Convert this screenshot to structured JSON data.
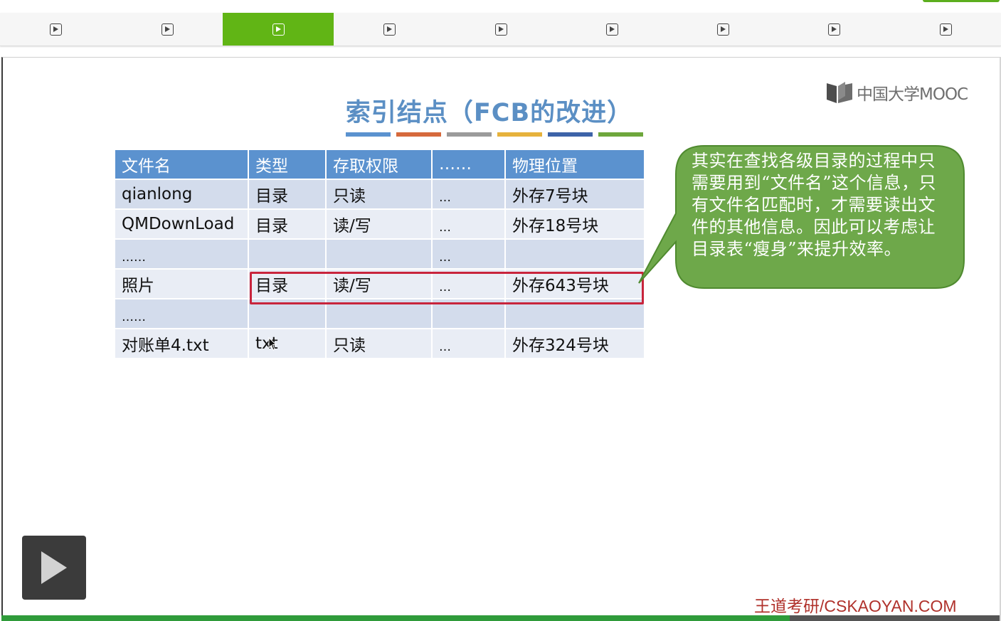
{
  "tabs": [
    {
      "icon": "play-icon",
      "active": false
    },
    {
      "icon": "play-icon",
      "active": false
    },
    {
      "icon": "play-icon",
      "active": true
    },
    {
      "icon": "play-icon",
      "active": false
    },
    {
      "icon": "play-icon",
      "active": false
    },
    {
      "icon": "play-icon",
      "active": false
    },
    {
      "icon": "play-icon",
      "active": false
    },
    {
      "icon": "play-icon",
      "active": false
    },
    {
      "icon": "play-icon",
      "active": false
    }
  ],
  "slide": {
    "title": "索引结点（FCB的改进）",
    "title_bar_colors": [
      "#5b92cf",
      "#d6693c",
      "#9b9b9b",
      "#e6b23c",
      "#3d63a8",
      "#6ea73c"
    ],
    "logo_text": "中国大学MOOC",
    "table": {
      "headers": [
        "文件名",
        "类型",
        "存取权限",
        "……",
        "物理位置"
      ],
      "rows": [
        [
          "qianlong",
          "目录",
          "只读",
          "…",
          "外存7号块"
        ],
        [
          "QMDownLoad",
          "目录",
          "读/写",
          "…",
          "外存18号块"
        ],
        [
          "……",
          "",
          "",
          "…",
          ""
        ],
        [
          "照片",
          "目录",
          "读/写",
          "…",
          "外存643号块"
        ],
        [
          "……",
          "",
          "",
          "",
          ""
        ],
        [
          "对账单4.txt",
          "txt",
          "只读",
          "…",
          "外存324号块"
        ]
      ],
      "highlight_color": "#c8243c"
    },
    "callout": {
      "text": "其实在查找各级目录的过程中只需要用到“文件名”这个信息，只有文件名匹配时，才需要读出文件的其他信息。因此可以考虑让目录表“瘦身”来提升效率。",
      "fill": "#6ea84a"
    },
    "watermark": "王道考研/CSKAOYAN.COM"
  },
  "player": {
    "play_icon": "play-icon",
    "progress": 0.79,
    "accent": "#61b515"
  }
}
